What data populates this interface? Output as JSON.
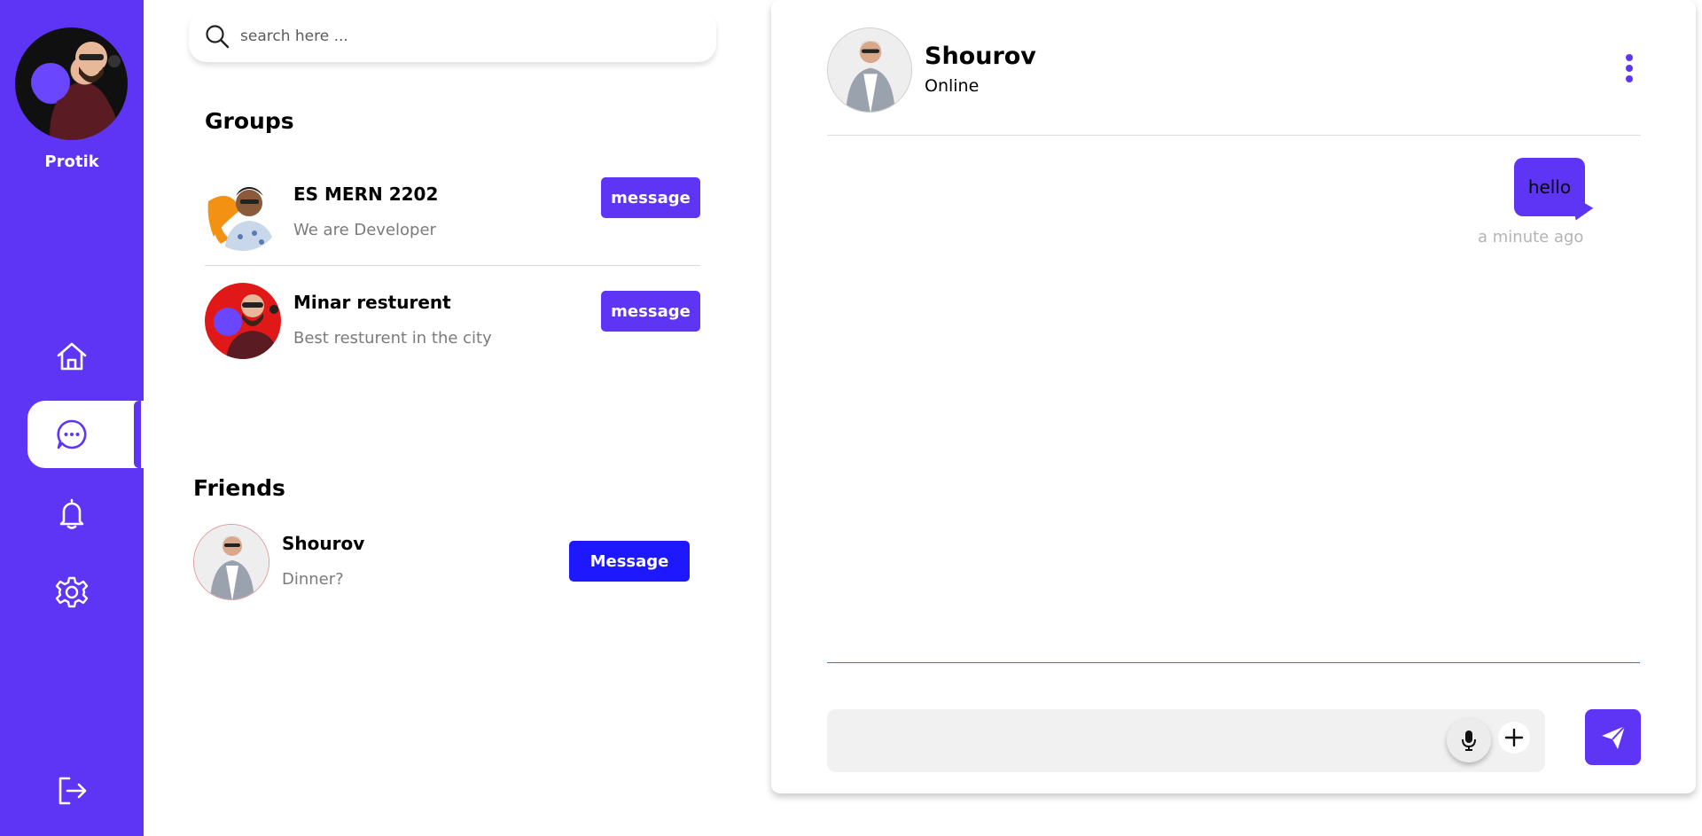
{
  "user": {
    "name": "Protik"
  },
  "nav": {
    "items": [
      {
        "icon": "home-icon"
      },
      {
        "icon": "message-icon",
        "active": true
      },
      {
        "icon": "bell-icon"
      },
      {
        "icon": "gear-icon"
      }
    ],
    "logout_icon": "logout-icon"
  },
  "search": {
    "placeholder": "search here ..."
  },
  "groups": {
    "title": "Groups",
    "items": [
      {
        "name": "ES MERN 2202",
        "subtitle": "We are Developer",
        "button": "message"
      },
      {
        "name": "Minar resturent",
        "subtitle": "Best resturent in the city",
        "button": "message"
      }
    ]
  },
  "friends": {
    "title": "Friends",
    "items": [
      {
        "name": "Shourov",
        "subtitle": "Dinner?",
        "button": "Message"
      }
    ]
  },
  "chat": {
    "contact_name": "Shourov",
    "status": "Online",
    "messages": [
      {
        "text": "hello",
        "time": "a minute ago",
        "from_me": true
      }
    ],
    "composer_value": ""
  },
  "colors": {
    "accent": "#5f35f5",
    "friend_button": "#1e18ff",
    "input_bg": "#f1f1f1"
  }
}
